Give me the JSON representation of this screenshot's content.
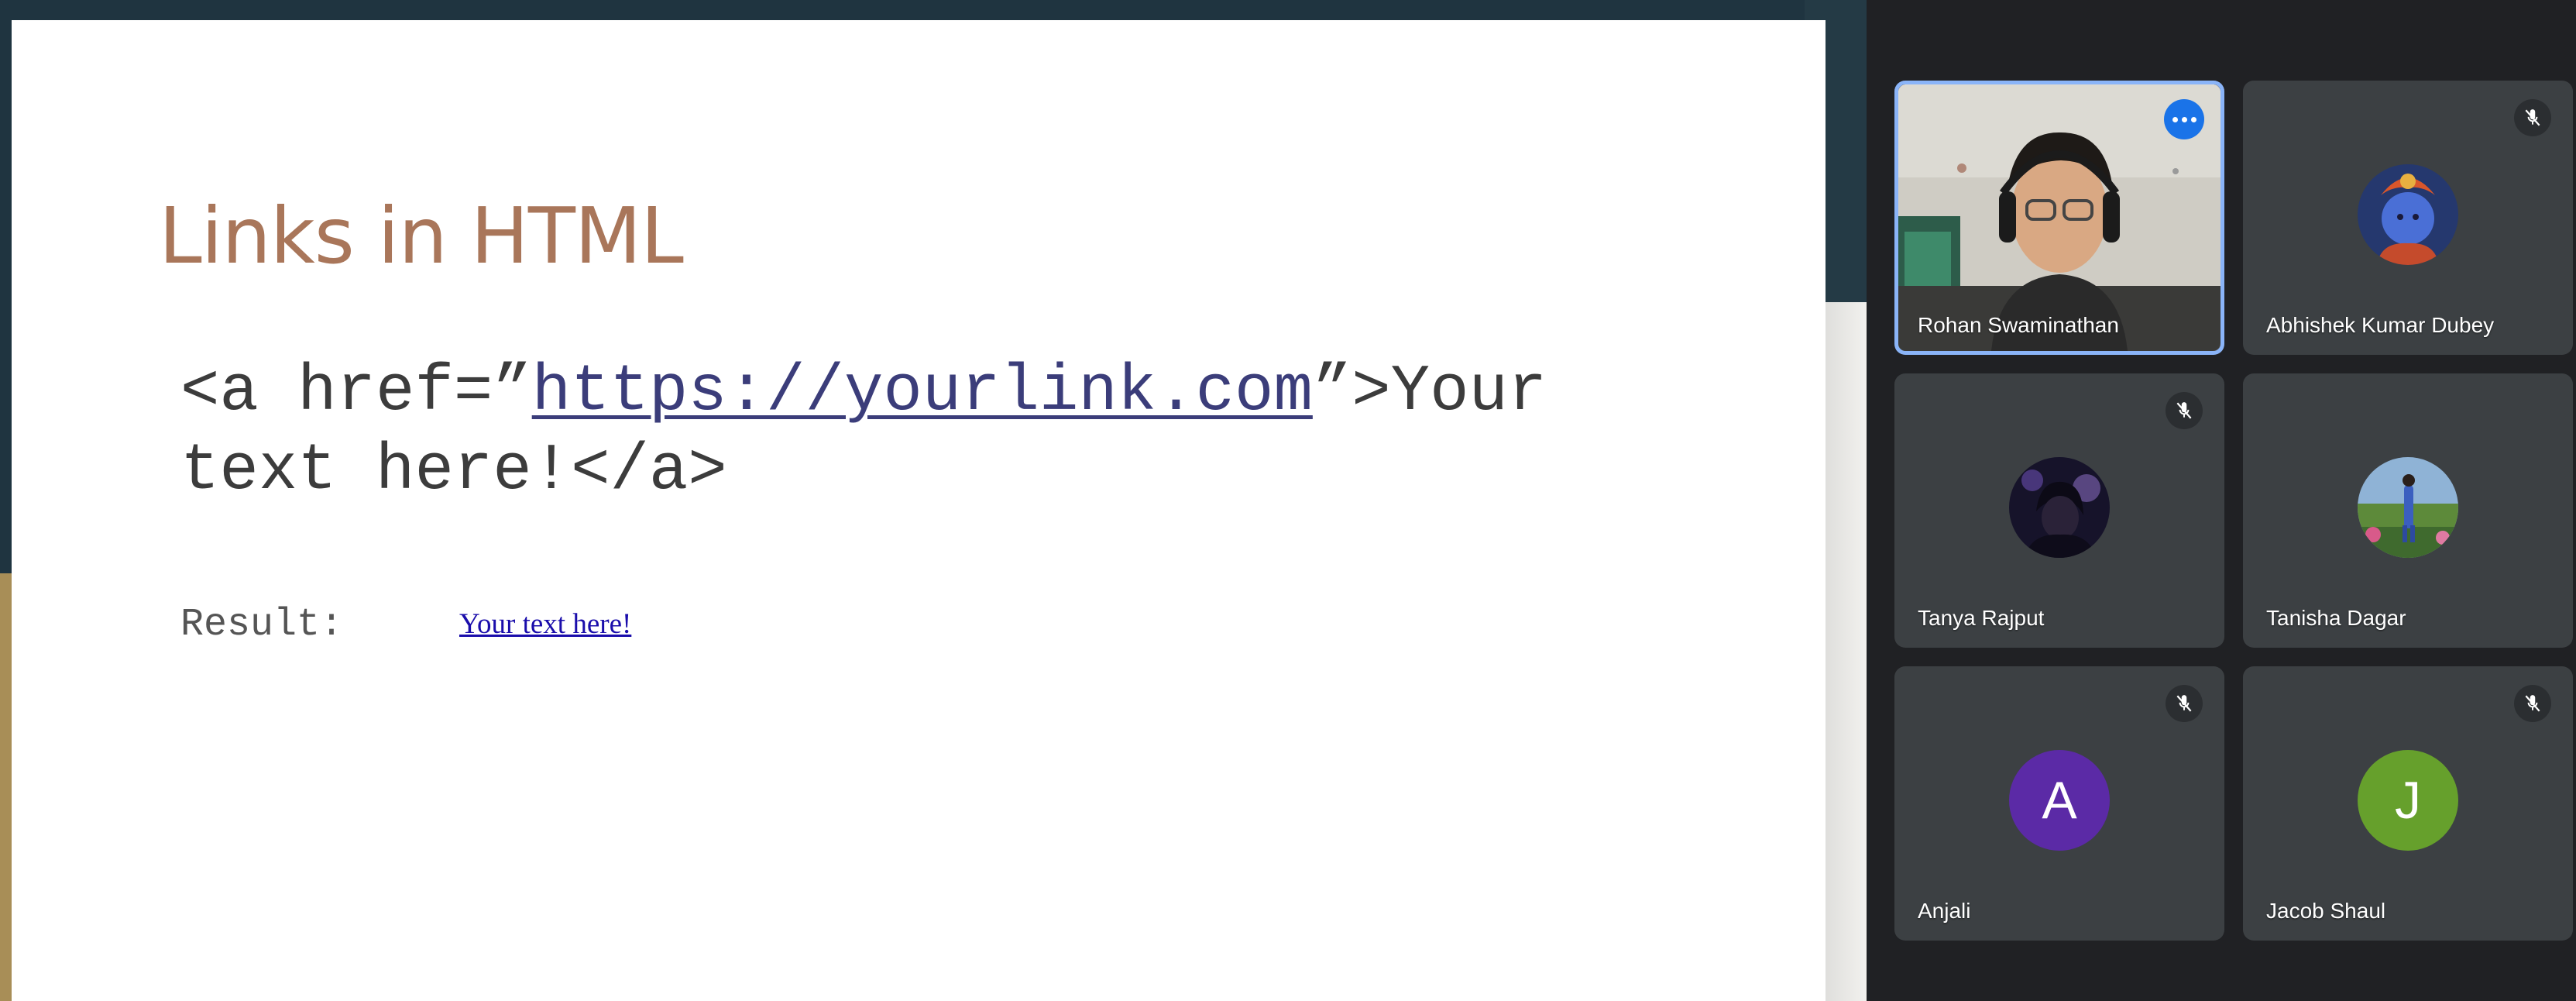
{
  "slide": {
    "title": "Links in HTML",
    "code_prefix": "<a href=”",
    "code_url": "https://yourlink.com",
    "code_suffix": "”>Your text here!</a>",
    "result_label": "Result:",
    "result_link_text": "Your text here!"
  },
  "participants": [
    {
      "name": "Rohan Swaminathan",
      "type": "video",
      "active": true,
      "icon": "more-options-icon"
    },
    {
      "name": "Abhishek Kumar Dubey",
      "type": "avatar-image",
      "muted": true,
      "icon": "mic-off-icon"
    },
    {
      "name": "Tanya Rajput",
      "type": "avatar-image",
      "muted": true,
      "icon": "mic-off-icon"
    },
    {
      "name": "Tanisha Dagar",
      "type": "avatar-image",
      "muted": false
    },
    {
      "name": "Anjali",
      "type": "initial",
      "initial": "A",
      "color": "#5b2aa6",
      "muted": true,
      "icon": "mic-off-icon"
    },
    {
      "name": "Jacob Shaul",
      "type": "initial",
      "initial": "J",
      "color": "#66a02c",
      "muted": true,
      "icon": "mic-off-icon"
    }
  ],
  "colors": {
    "meet_background": "#202124",
    "tile_background": "#3c4043",
    "active_border": "#8ab4f8",
    "title_color": "#a9765a",
    "link_color": "#1a0dab"
  }
}
